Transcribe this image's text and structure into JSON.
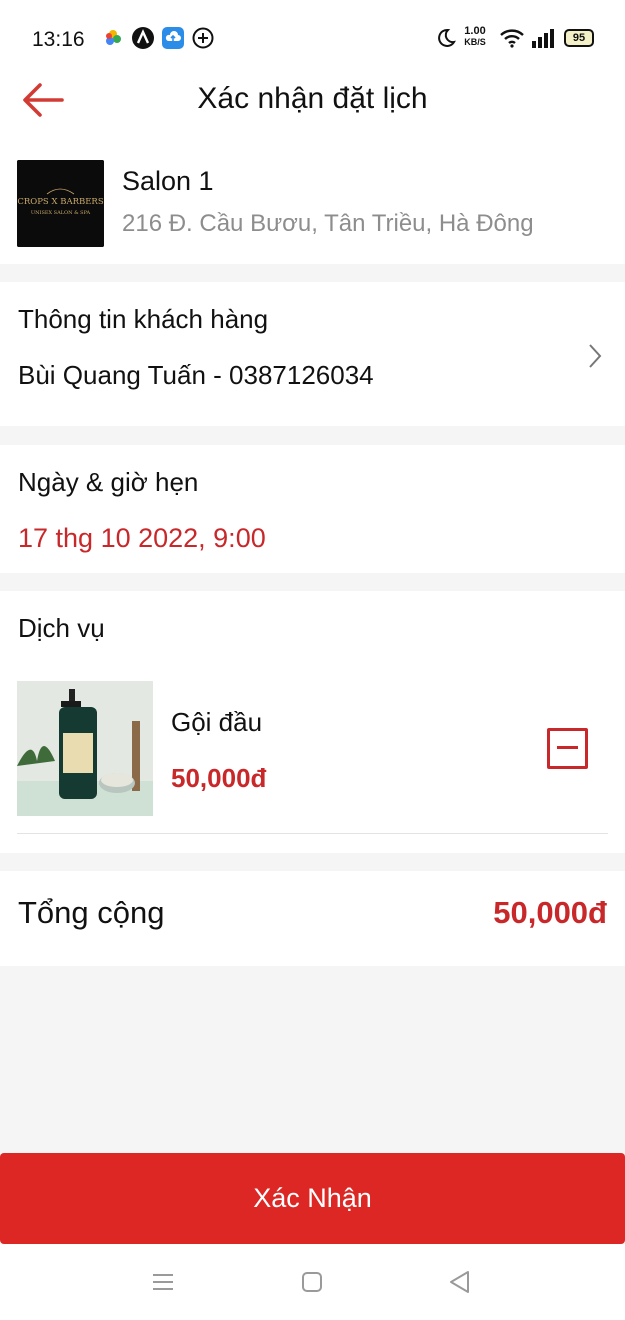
{
  "status_bar": {
    "time": "13:16",
    "net_speed": "1.00",
    "net_unit": "KB/S",
    "battery": "95"
  },
  "header": {
    "title": "Xác nhận đặt lịch"
  },
  "salon": {
    "name": "Salon 1",
    "address": "216 Đ. Cầu Bươu, Tân Triều, Hà Đông",
    "logo_text_1": "CROPS X BARBERS",
    "logo_text_2": "UNISEX SALON & SPA"
  },
  "customer": {
    "title": "Thông tin khách hàng",
    "value": "Bùi Quang Tuấn - 0387126034"
  },
  "appointment": {
    "title": "Ngày & giờ hẹn",
    "value": "17 thg 10 2022, 9:00"
  },
  "services": {
    "title": "Dịch vụ",
    "items": [
      {
        "name": "Gội đầu",
        "price": "50,000đ"
      }
    ]
  },
  "total": {
    "label": "Tổng cộng",
    "value": "50,000đ"
  },
  "confirm": {
    "label": "Xác Nhận"
  },
  "colors": {
    "accent": "#dc2725",
    "price": "#c8282a"
  }
}
